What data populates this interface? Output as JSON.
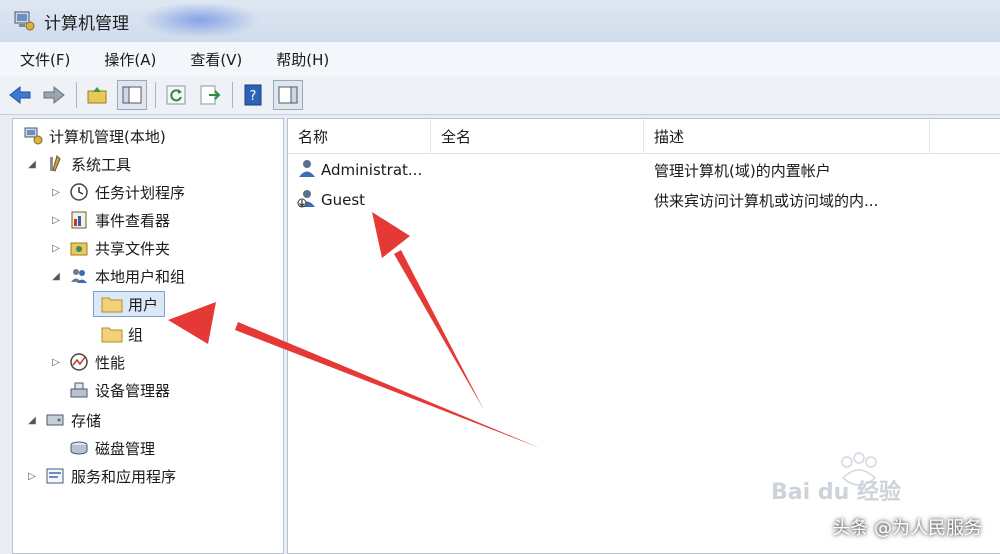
{
  "window": {
    "title": "计算机管理"
  },
  "menu": [
    {
      "label": "文件(F)"
    },
    {
      "label": "操作(A)"
    },
    {
      "label": "查看(V)"
    },
    {
      "label": "帮助(H)"
    }
  ],
  "tree": [
    {
      "label": "计算机管理(本地)",
      "icon": "computer-management-icon"
    },
    {
      "label": "系统工具",
      "icon": "tools-icon"
    },
    {
      "label": "任务计划程序",
      "icon": "clock-icon"
    },
    {
      "label": "事件查看器",
      "icon": "event-viewer-icon"
    },
    {
      "label": "共享文件夹",
      "icon": "shared-folder-icon"
    },
    {
      "label": "本地用户和组",
      "icon": "users-icon"
    },
    {
      "label": "用户",
      "icon": "folder-icon"
    },
    {
      "label": "组",
      "icon": "folder-icon"
    },
    {
      "label": "性能",
      "icon": "performance-icon"
    },
    {
      "label": "设备管理器",
      "icon": "device-manager-icon"
    },
    {
      "label": "存储",
      "icon": "storage-icon"
    },
    {
      "label": "磁盘管理",
      "icon": "disk-icon"
    },
    {
      "label": "服务和应用程序",
      "icon": "services-icon"
    }
  ],
  "columns": [
    {
      "label": "名称"
    },
    {
      "label": "全名"
    },
    {
      "label": "描述"
    }
  ],
  "rows": [
    {
      "name": "Administrat...",
      "fullname": "",
      "description": "管理计算机(域)的内置帐户",
      "icon": "user-icon"
    },
    {
      "name": "Guest",
      "fullname": "",
      "description": "供来宾访问计算机或访问域的内...",
      "icon": "user-disabled-icon"
    }
  ],
  "watermark": {
    "text": "Bai du 经验"
  },
  "caption": {
    "text": "头条 @为人民服务"
  },
  "colors": {
    "arrow": "#e53935",
    "accent": "#3b6db4"
  }
}
